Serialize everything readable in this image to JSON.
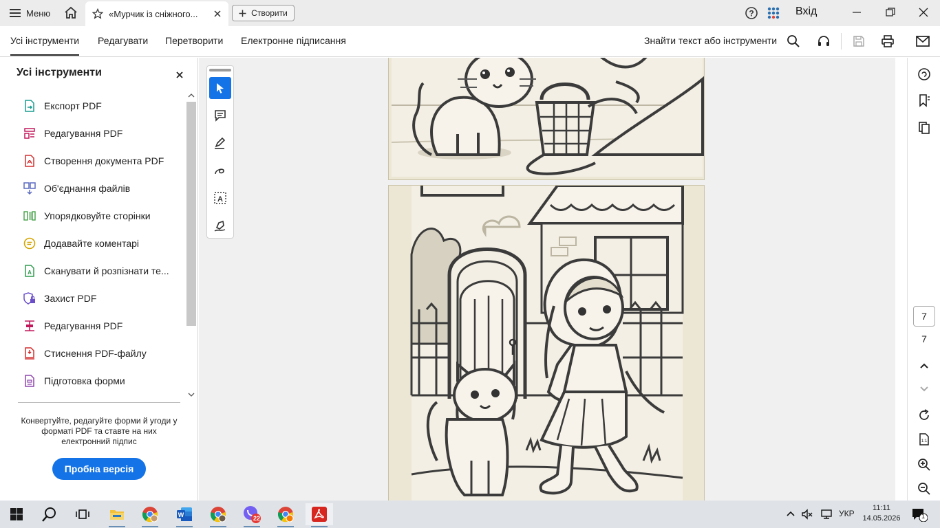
{
  "titlebar": {
    "menu_label": "Меню",
    "tab_title": "«Мурчик із сніжного...",
    "create_label": "Створити",
    "signin_label": "Вхід"
  },
  "toolbar": {
    "tabs": [
      "Усі інструменти",
      "Редагувати",
      "Перетворити",
      "Електронне підписання"
    ],
    "active_tab": "Усі інструменти",
    "find_label": "Знайти текст або інструменти"
  },
  "left_panel": {
    "title": "Усі інструменти",
    "tools": [
      {
        "label": "Експорт PDF",
        "icon": "export-pdf-icon",
        "color": "#1a9c8f"
      },
      {
        "label": "Редагування PDF",
        "icon": "edit-pdf-icon",
        "color": "#c2185b"
      },
      {
        "label": "Створення документа PDF",
        "icon": "create-pdf-icon",
        "color": "#d32f2f"
      },
      {
        "label": "Об'єднання файлів",
        "icon": "combine-files-icon",
        "color": "#5c6bc0"
      },
      {
        "label": "Упорядковуйте сторінки",
        "icon": "organize-pages-icon",
        "color": "#43a047"
      },
      {
        "label": "Додавайте коментарі",
        "icon": "comment-icon",
        "color": "#e6b800"
      },
      {
        "label": "Сканувати й розпізнати те...",
        "icon": "scan-ocr-icon",
        "color": "#2e9b4e"
      },
      {
        "label": "Захист PDF",
        "icon": "protect-pdf-icon",
        "color": "#6a4fc8"
      },
      {
        "label": "Редагування PDF",
        "icon": "redact-pdf-icon",
        "color": "#c2185b"
      },
      {
        "label": "Стиснення PDF-файлу",
        "icon": "compress-pdf-icon",
        "color": "#d32f2f"
      },
      {
        "label": "Підготовка форми",
        "icon": "prepare-form-icon",
        "color": "#8e44ad"
      }
    ],
    "promo_text": "Конвертуйте, редагуйте форми й угоди у форматі PDF та ставте на них електронний підпис",
    "trial_label": "Пробна версія"
  },
  "navigation": {
    "current_page": "7",
    "total_pages": "7"
  },
  "taskbar": {
    "language": "УКР",
    "time": "11:11",
    "date": "14.05.2026",
    "viber_badge": "22",
    "notification_count": "1"
  },
  "colors": {
    "accent": "#1473e6",
    "page_bg": "#ede8d8",
    "line_art": "#444444"
  }
}
